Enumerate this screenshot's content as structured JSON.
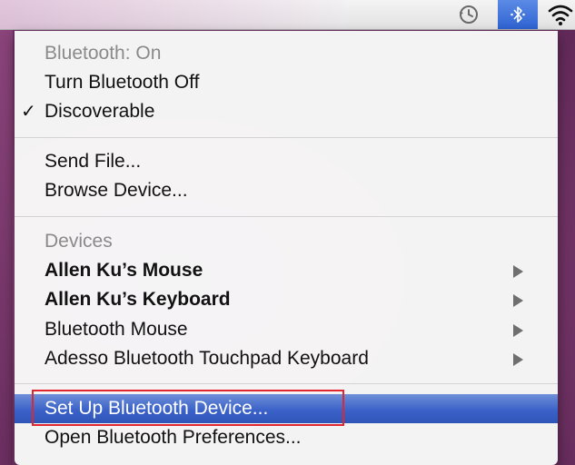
{
  "menu": {
    "status_header": "Bluetooth: On",
    "turn_off": "Turn Bluetooth Off",
    "discoverable": "Discoverable",
    "discoverable_check": "✓",
    "send_file": "Send File...",
    "browse_device": "Browse Device...",
    "devices_header": "Devices",
    "devices": [
      {
        "label": "Allen Ku’s Mouse"
      },
      {
        "label": "Allen Ku’s Keyboard"
      },
      {
        "label": "Bluetooth Mouse"
      },
      {
        "label": "Adesso Bluetooth Touchpad Keyboard"
      }
    ],
    "setup": "Set Up Bluetooth Device...",
    "preferences": "Open Bluetooth Preferences..."
  },
  "menubar": {
    "icons": [
      "time-machine-icon",
      "bluetooth-icon",
      "wifi-icon"
    ]
  },
  "colors": {
    "highlight": "#3b62c8",
    "annotation_box": "#e0262f"
  }
}
